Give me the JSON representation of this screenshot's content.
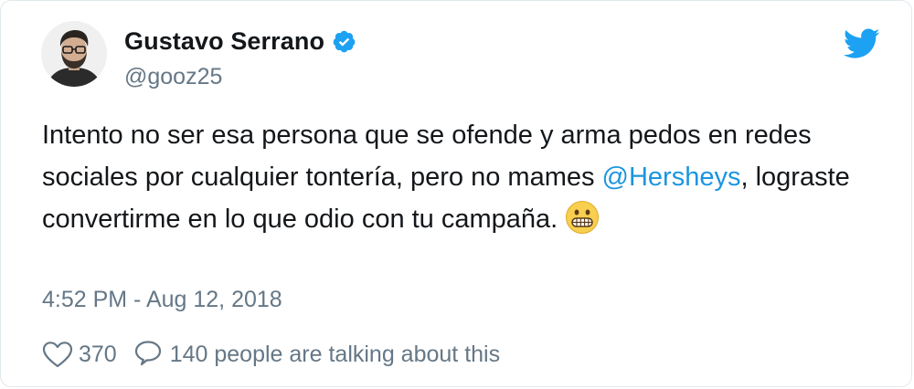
{
  "tweet": {
    "user": {
      "display_name": "Gustavo Serrano",
      "handle": "@gooz25",
      "verified": true,
      "avatar_icon": "profile-photo"
    },
    "text": {
      "part1": "Intento no ser esa persona que se ofende y arma pedos en redes sociales por cualquier tontería, pero no mames ",
      "mention": "@Hersheys",
      "part2": ", lograste convertirme en lo que odio con tu campaña.",
      "emoji": "grimacing-face-emoji"
    },
    "timestamp": "4:52 PM - Aug 12, 2018",
    "actions": {
      "like_count": "370",
      "talking_text": "140 people are talking about this"
    },
    "colors": {
      "text": "#14171a",
      "secondary": "#657786",
      "link": "#1b95e0",
      "twitter_blue": "#1da1f2"
    },
    "icons": {
      "brand": "twitter-bird-icon",
      "verified": "verified-badge-icon",
      "like": "heart-icon",
      "reply": "speech-bubble-icon"
    }
  }
}
